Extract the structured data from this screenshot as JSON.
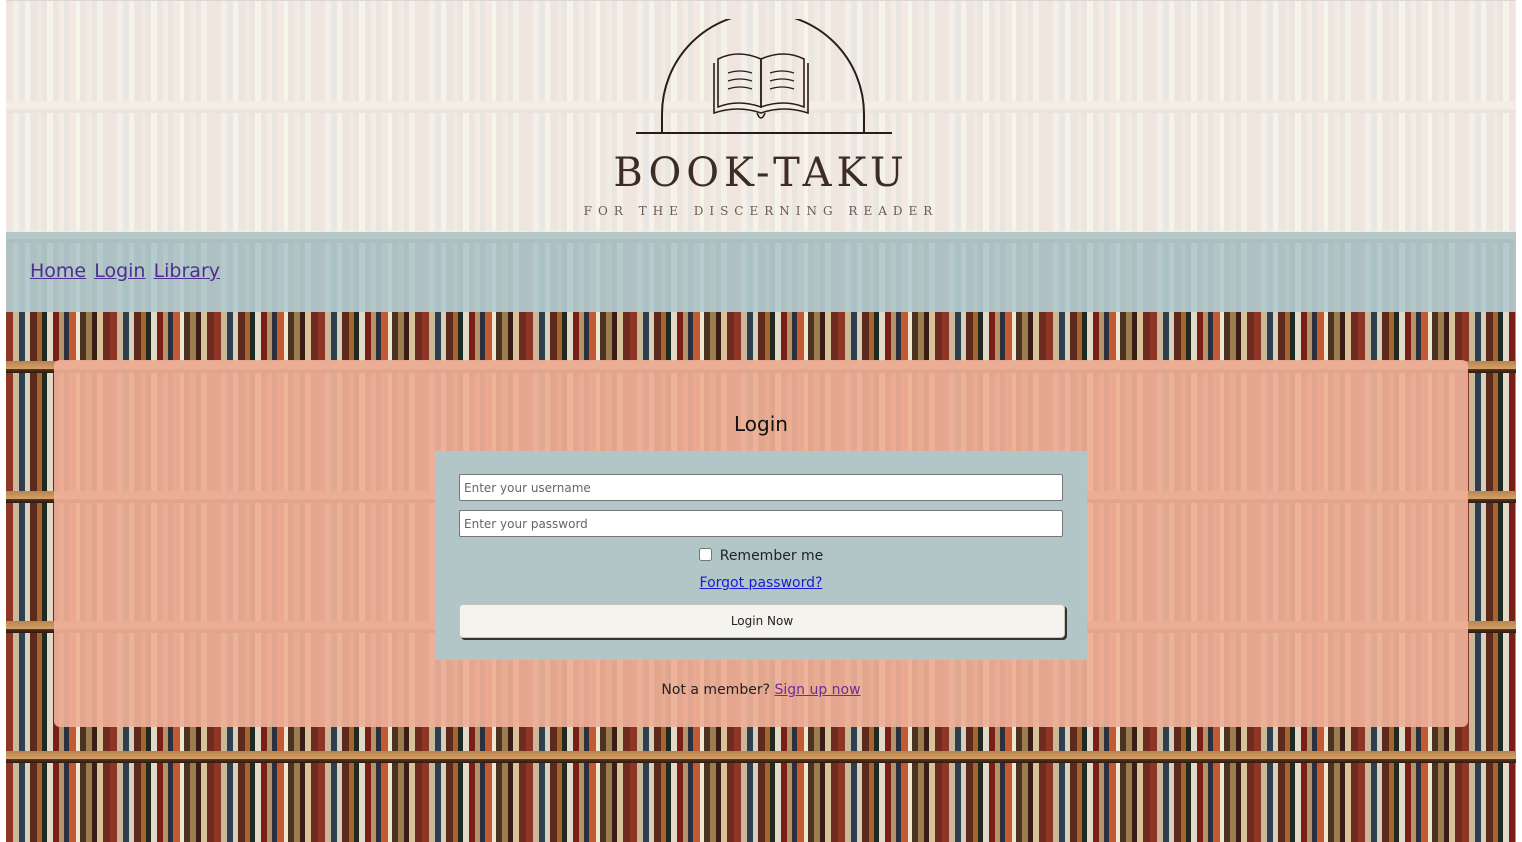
{
  "header": {
    "logo_icon": "open-book-arch-icon",
    "brand": "BOOK-TAKU",
    "tagline": "FOR THE DISCERNING READER"
  },
  "nav": {
    "items": [
      {
        "label": "Home"
      },
      {
        "label": "Login"
      },
      {
        "label": "Library"
      }
    ]
  },
  "login": {
    "title": "Login",
    "username_placeholder": "Enter your username",
    "password_placeholder": "Enter your password",
    "remember_label": "Remember me",
    "remember_checked": false,
    "forgot_link": "Forgot password?",
    "submit_label": "Login Now",
    "signup_prompt": "Not a member?",
    "signup_link": "Sign up now"
  },
  "colors": {
    "header_bg": "#f7f4ee",
    "nav_bg": "#b2cacd",
    "panel_bg": "#eeaf98",
    "form_bg": "#b2c6c7",
    "link": "#4d2f93"
  }
}
